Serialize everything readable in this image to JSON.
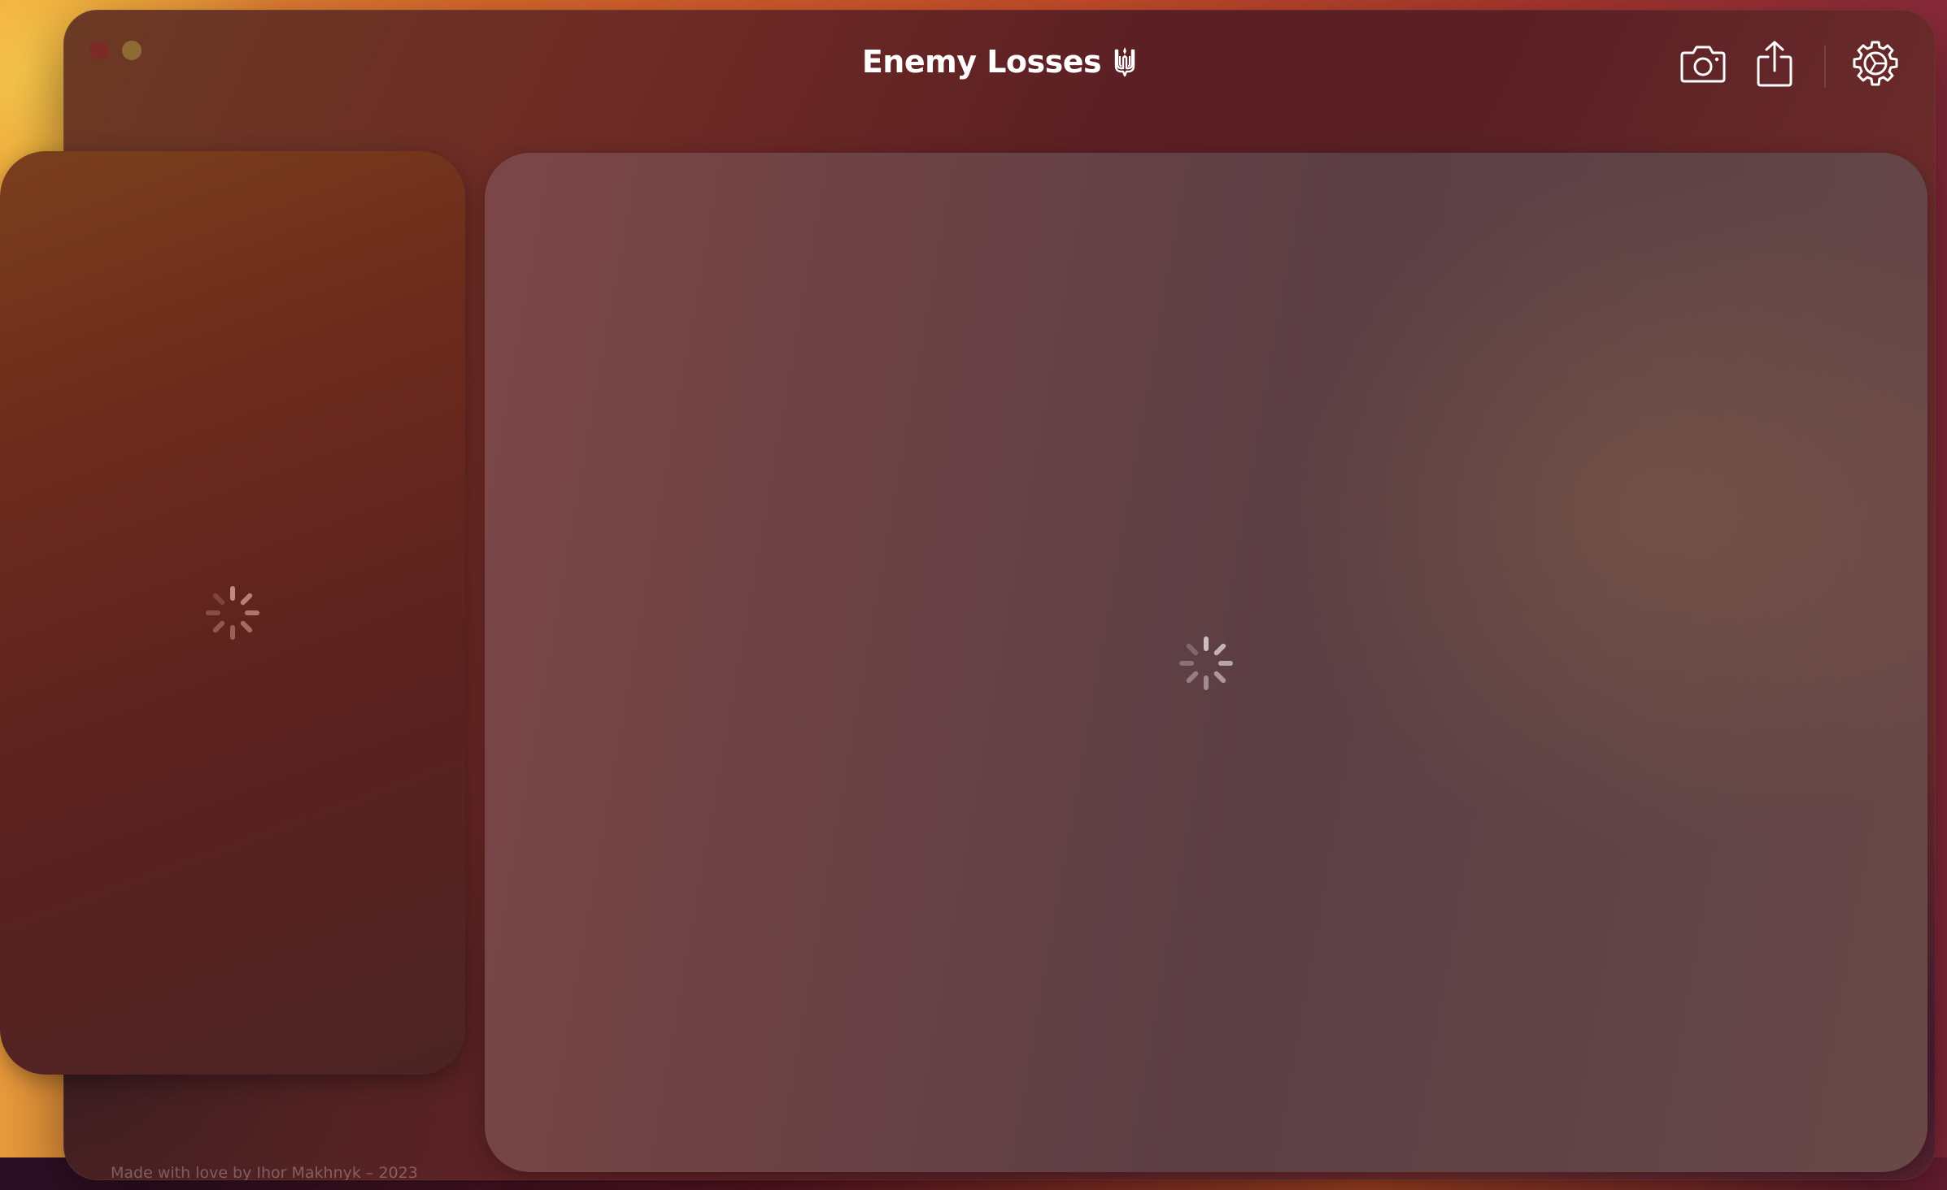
{
  "app": {
    "title": "Enemy Losses",
    "title_icon": "ukrainian-trident-icon"
  },
  "toolbar": {
    "items": [
      {
        "name": "screenshot",
        "icon": "camera-icon"
      },
      {
        "name": "share",
        "icon": "share-icon"
      },
      {
        "name": "settings",
        "icon": "gear-icon"
      }
    ]
  },
  "side_panel": {
    "state": "loading",
    "indicator": "spinner-icon"
  },
  "main_panel": {
    "state": "loading",
    "indicator": "spinner-icon"
  },
  "footer": {
    "text": "Made with love by Ihor Makhnyk – 2023"
  },
  "colors": {
    "accent": "#ffffff",
    "side_panel": "#5c2220",
    "main_panel": "#5a3e44"
  }
}
